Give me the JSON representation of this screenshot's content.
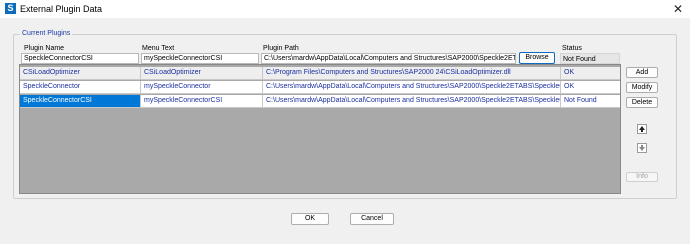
{
  "window": {
    "title": "External Plugin Data",
    "app_icon_glyph": "S",
    "close_glyph": "✕"
  },
  "group": {
    "legend": "Current Plugins"
  },
  "columns": {
    "plugin_name": "Plugin Name",
    "menu_text": "Menu Text",
    "plugin_path": "Plugin Path",
    "status": "Status"
  },
  "editor": {
    "plugin_name": "SpeckleConnectorCSI",
    "menu_text": "mySpeckleConnectorCSI",
    "plugin_path": "C:\\Users\\mardw\\AppData\\Local\\Computers and Structures\\SAP2000\\Speckle2ETABS",
    "browse_label": "Browse",
    "status": "Not Found"
  },
  "rows": [
    {
      "name": "CSiLoadOptimizer",
      "menu": "CSiLoadOptimizer",
      "path": "C:\\Program Files\\Computers and Structures\\SAP2000 24\\CSiLoadOptimizer.dll",
      "status": "OK"
    },
    {
      "name": "SpeckleConnector",
      "menu": "mySpeckleConnector",
      "path": "C:\\Users\\mardw\\AppData\\Local\\Computers and Structures\\SAP2000\\Speckle2ETABS\\SpeckleCon...",
      "status": "OK"
    },
    {
      "name": "SpeckleConnectorCSI",
      "menu": "mySpeckleConnectorCSI",
      "path": "C:\\Users\\mardw\\AppData\\Local\\Computers and Structures\\SAP2000\\Speckle2ETABS\\SpeckleCon...",
      "status": "Not Found"
    }
  ],
  "side_buttons": {
    "add": "Add",
    "modify": "Modify",
    "delete": "Delete",
    "info": "Info"
  },
  "footer": {
    "ok": "OK",
    "cancel": "Cancel"
  },
  "colors": {
    "accent": "#0f6cbd",
    "selection": "#0078d7",
    "cell_text": "#1a2fa0",
    "grid_background": "#a9a9a9"
  }
}
